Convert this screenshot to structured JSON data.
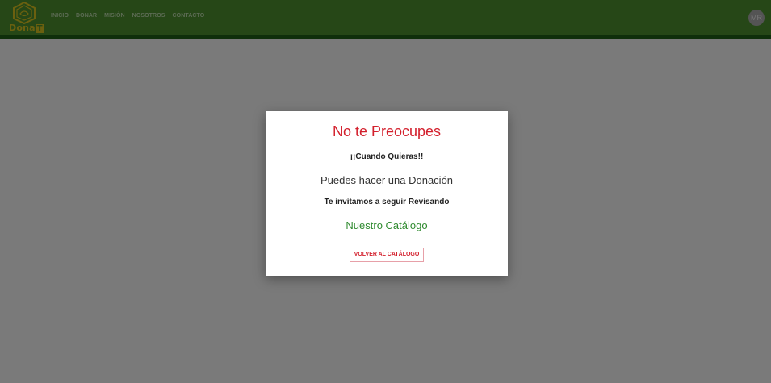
{
  "navbar": {
    "logo_text": "Dona",
    "logo_badge": "T",
    "links": [
      "INICIO",
      "DONAR",
      "MISIÓN",
      "NOSOTROS",
      "CONTACTO"
    ],
    "avatar_initials": "MR",
    "colors": {
      "bar": "#4d8f2f",
      "bar_border": "#1f5e16",
      "logo": "#d6c11e"
    }
  },
  "modal": {
    "title": "No te Preocupes",
    "line1": "¡¡Cuando Quieras!!",
    "line2": "Puedes hacer una Donación",
    "line3": "Te invitamos a seguir Revisando",
    "line4": "Nuestro Catálogo",
    "button_label": "Volver al catálogo",
    "colors": {
      "title": "#d3202d",
      "link": "#2f8a2f"
    }
  }
}
